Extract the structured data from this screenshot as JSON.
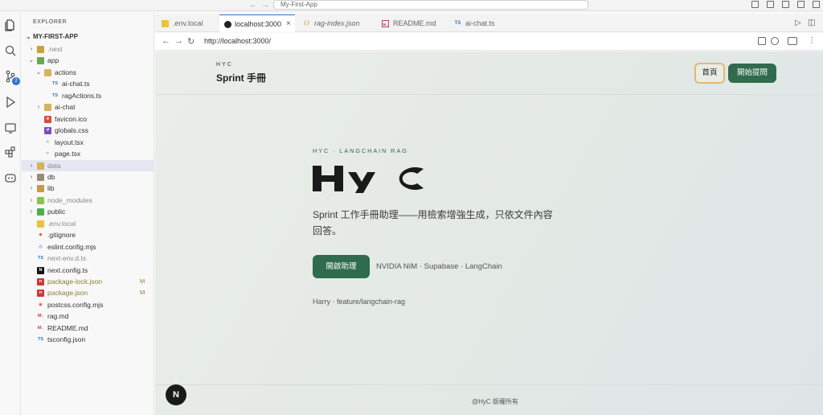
{
  "titlebar": {
    "search_text": "My-First-App",
    "back": "←",
    "forward": "→"
  },
  "activity": {
    "scm_badge": "2"
  },
  "sidebar": {
    "header": "EXPLORER",
    "root": "MY-FIRST-APP",
    "items": [
      {
        "label": ".next",
        "icon": "next-folder-icon",
        "chev": "›"
      },
      {
        "label": "app",
        "icon": "app-folder-icon",
        "chev": "⌄"
      },
      {
        "label": "actions",
        "icon": "folder-icon",
        "chev": "⌄"
      },
      {
        "label": "ai-chat.ts",
        "icon": "typescript-file-icon",
        "chev": ""
      },
      {
        "label": "ragActions.ts",
        "icon": "typescript-file-icon",
        "chev": ""
      },
      {
        "label": "ai-chat",
        "icon": "folder-icon",
        "chev": "›"
      },
      {
        "label": "favicon.ico",
        "icon": "favicon-file-icon",
        "chev": ""
      },
      {
        "label": "globals.css",
        "icon": "css-file-icon",
        "chev": ""
      },
      {
        "label": "layout.tsx",
        "icon": "react-file-icon",
        "chev": ""
      },
      {
        "label": "page.tsx",
        "icon": "react-file-icon",
        "chev": ""
      },
      {
        "label": "data",
        "icon": "folder-icon",
        "chev": "›"
      },
      {
        "label": "db",
        "icon": "db-folder-icon",
        "chev": "›"
      },
      {
        "label": "lib",
        "icon": "lib-folder-icon",
        "chev": "›"
      },
      {
        "label": "node_modules",
        "icon": "node-modules-folder-icon",
        "chev": "›"
      },
      {
        "label": "public",
        "icon": "public-folder-icon",
        "chev": "›"
      },
      {
        "label": ".env.local",
        "icon": "env-file-icon",
        "chev": ""
      },
      {
        "label": ".gitignore",
        "icon": "git-file-icon",
        "chev": ""
      },
      {
        "label": "eslint.config.mjs",
        "icon": "eslint-file-icon",
        "chev": ""
      },
      {
        "label": "next-env.d.ts",
        "icon": "typescript-file-icon",
        "chev": ""
      },
      {
        "label": "next.config.ts",
        "icon": "next-file-icon",
        "chev": ""
      },
      {
        "label": "package-lock.json",
        "icon": "npm-file-icon",
        "chev": "",
        "status": "M"
      },
      {
        "label": "package.json",
        "icon": "npm-file-icon",
        "chev": "",
        "status": "M"
      },
      {
        "label": "postcss.config.mjs",
        "icon": "postcss-file-icon",
        "chev": ""
      },
      {
        "label": "rag.md",
        "icon": "markdown-file-icon",
        "chev": ""
      },
      {
        "label": "README.md",
        "icon": "markdown-file-icon",
        "chev": ""
      },
      {
        "label": "tsconfig.json",
        "icon": "typescript-file-icon",
        "chev": ""
      }
    ]
  },
  "tabs": [
    {
      "label": ".env.local",
      "icon": "env-file-icon"
    },
    {
      "label": "localhost:3000",
      "icon": "browser-icon",
      "close": "×"
    },
    {
      "label": "rag-index.json",
      "icon": "json-file-icon"
    },
    {
      "label": "README.md",
      "icon": "markdown-file-icon"
    },
    {
      "label": "ai-chat.ts",
      "icon": "typescript-file-icon"
    }
  ],
  "browser": {
    "url": "http://localhost:3000/"
  },
  "webpage": {
    "brand_small": "HYC",
    "brand_title": "Sprint 手冊",
    "nav_home": "首頁",
    "nav_ask": "開始提問",
    "eyebrow": "HYC · LANGCHAIN RAG",
    "hero_logo": "HyC",
    "hero_desc": "Sprint 工作手冊助理——用檢索增強生成，只依文件內容回答。",
    "cta": "開啟助理",
    "tech": "NVIDIA NIM · Supabase · LangChain",
    "author": "Harry · feature/langchain-rag",
    "copyright": "@HyC 版權所有",
    "next_badge": "N"
  },
  "colors": {
    "accent": "#2f6b4c",
    "highlight": "#e6b96c",
    "selection": "#e4e6f1"
  }
}
